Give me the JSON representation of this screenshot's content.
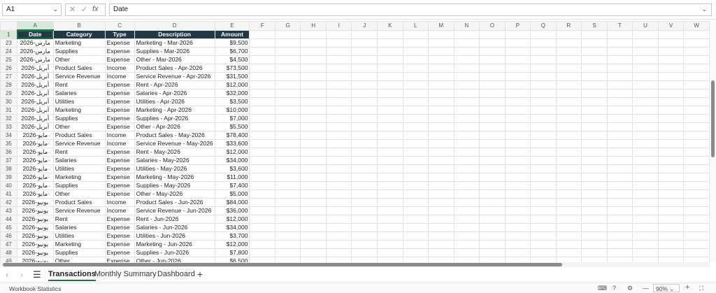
{
  "formula_bar": {
    "cell_ref": "A1",
    "cancel_glyph": "✕",
    "confirm_glyph": "✓",
    "fx_label": "fx",
    "content": "Date",
    "dropdown_glyph": "⌄"
  },
  "grid": {
    "columns": [
      "A",
      "B",
      "C",
      "D",
      "E",
      "F",
      "G",
      "H",
      "I",
      "J",
      "K",
      "L",
      "M",
      "N",
      "O",
      "P",
      "Q",
      "R",
      "S",
      "T",
      "U",
      "V",
      "W"
    ],
    "active_column": "A",
    "header_row_number": "1",
    "headers": [
      "Date",
      "Category",
      "Type",
      "Description",
      "Amount"
    ],
    "rows": [
      {
        "n": "23",
        "date": "مارس-2026",
        "category": "Marketing",
        "type": "Expense",
        "description": "Marketing - Mar-2026",
        "amount": "$9,500"
      },
      {
        "n": "24",
        "date": "مارس-2026",
        "category": "Supplies",
        "type": "Expense",
        "description": "Supplies - Mar-2026",
        "amount": "$6,700"
      },
      {
        "n": "25",
        "date": "مارس-2026",
        "category": "Other",
        "type": "Expense",
        "description": "Other - Mar-2026",
        "amount": "$4,500"
      },
      {
        "n": "26",
        "date": "أبريل-2026",
        "category": "Product Sales",
        "type": "Income",
        "description": "Product Sales - Apr-2026",
        "amount": "$73,500"
      },
      {
        "n": "27",
        "date": "أبريل-2026",
        "category": "Service Revenue",
        "type": "Income",
        "description": "Service Revenue - Apr-2026",
        "amount": "$31,500"
      },
      {
        "n": "28",
        "date": "أبريل-2026",
        "category": "Rent",
        "type": "Expense",
        "description": "Rent - Apr-2026",
        "amount": "$12,000"
      },
      {
        "n": "29",
        "date": "أبريل-2026",
        "category": "Salaries",
        "type": "Expense",
        "description": "Salaries - Apr-2026",
        "amount": "$32,000"
      },
      {
        "n": "30",
        "date": "أبريل-2026",
        "category": "Utilities",
        "type": "Expense",
        "description": "Utilities - Apr-2026",
        "amount": "$3,500"
      },
      {
        "n": "31",
        "date": "أبريل-2026",
        "category": "Marketing",
        "type": "Expense",
        "description": "Marketing - Apr-2026",
        "amount": "$10,000"
      },
      {
        "n": "32",
        "date": "أبريل-2026",
        "category": "Supplies",
        "type": "Expense",
        "description": "Supplies - Apr-2026",
        "amount": "$7,000"
      },
      {
        "n": "33",
        "date": "أبريل-2026",
        "category": "Other",
        "type": "Expense",
        "description": "Other - Apr-2026",
        "amount": "$5,500"
      },
      {
        "n": "34",
        "date": "مايو-2026",
        "category": "Product Sales",
        "type": "Income",
        "description": "Product Sales - May-2026",
        "amount": "$78,400"
      },
      {
        "n": "35",
        "date": "مايو-2026",
        "category": "Service Revenue",
        "type": "Income",
        "description": "Service Revenue - May-2026",
        "amount": "$33,600"
      },
      {
        "n": "36",
        "date": "مايو-2026",
        "category": "Rent",
        "type": "Expense",
        "description": "Rent - May-2026",
        "amount": "$12,000"
      },
      {
        "n": "37",
        "date": "مايو-2026",
        "category": "Salaries",
        "type": "Expense",
        "description": "Salaries - May-2026",
        "amount": "$34,000"
      },
      {
        "n": "38",
        "date": "مايو-2026",
        "category": "Utilities",
        "type": "Expense",
        "description": "Utilities - May-2026",
        "amount": "$3,600"
      },
      {
        "n": "39",
        "date": "مايو-2026",
        "category": "Marketing",
        "type": "Expense",
        "description": "Marketing - May-2026",
        "amount": "$11,000"
      },
      {
        "n": "40",
        "date": "مايو-2026",
        "category": "Supplies",
        "type": "Expense",
        "description": "Supplies - May-2026",
        "amount": "$7,400"
      },
      {
        "n": "41",
        "date": "مايو-2026",
        "category": "Other",
        "type": "Expense",
        "description": "Other - May-2026",
        "amount": "$5,000"
      },
      {
        "n": "42",
        "date": "يونيو-2026",
        "category": "Product Sales",
        "type": "Income",
        "description": "Product Sales - Jun-2026",
        "amount": "$84,000"
      },
      {
        "n": "43",
        "date": "يونيو-2026",
        "category": "Service Revenue",
        "type": "Income",
        "description": "Service Revenue - Jun-2026",
        "amount": "$36,000"
      },
      {
        "n": "44",
        "date": "يونيو-2026",
        "category": "Rent",
        "type": "Expense",
        "description": "Rent - Jun-2026",
        "amount": "$12,000"
      },
      {
        "n": "45",
        "date": "يونيو-2026",
        "category": "Salaries",
        "type": "Expense",
        "description": "Salaries - Jun-2026",
        "amount": "$34,000"
      },
      {
        "n": "46",
        "date": "يونيو-2026",
        "category": "Utilities",
        "type": "Expense",
        "description": "Utilities - Jun-2026",
        "amount": "$3,700"
      },
      {
        "n": "47",
        "date": "يونيو-2026",
        "category": "Marketing",
        "type": "Expense",
        "description": "Marketing - Jun-2026",
        "amount": "$12,000"
      },
      {
        "n": "48",
        "date": "يونيو-2026",
        "category": "Supplies",
        "type": "Expense",
        "description": "Supplies - Jun-2026",
        "amount": "$7,800"
      },
      {
        "n": "49",
        "date": "يونيو-2026",
        "category": "Other",
        "type": "Expense",
        "description": "Other - Jun-2026",
        "amount": "$6,500"
      }
    ]
  },
  "sheet_tabs": {
    "prev_glyph": "‹",
    "next_glyph": "›",
    "menu_glyph": "☰",
    "tabs": [
      "Transactions",
      "Monthly Summary",
      "Dashboard"
    ],
    "active_tab": "Transactions",
    "add_glyph": "+"
  },
  "status_bar": {
    "left_text": "Workbook Statistics",
    "zoom": "90%",
    "zoom_out_glyph": "—",
    "zoom_in_glyph": "+",
    "fullscreen_glyph": "⛶"
  },
  "colors": {
    "header_fill": "#213847",
    "accent": "#1e7145"
  },
  "icons": [
    "cancel-icon",
    "confirm-icon",
    "function-icon",
    "chevron-down-icon",
    "menu-icon",
    "add-icon",
    "keyboard-icon",
    "help-icon",
    "zoom-in-icon",
    "zoom-out-icon",
    "fullscreen-icon"
  ]
}
